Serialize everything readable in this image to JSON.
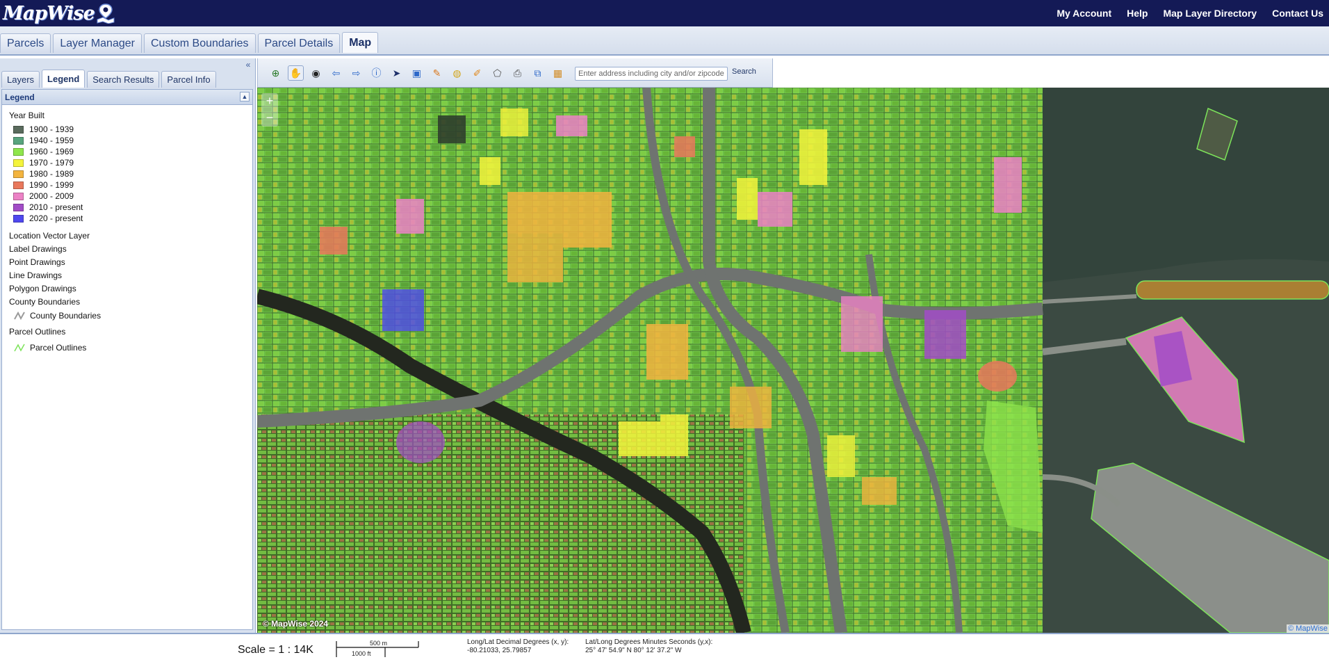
{
  "app": {
    "logo": "MapWise",
    "top_links": [
      "My Account",
      "Help",
      "Map Layer Directory",
      "Contact Us"
    ]
  },
  "main_tabs": [
    {
      "label": "Parcels",
      "active": false
    },
    {
      "label": "Layer Manager",
      "active": false
    },
    {
      "label": "Custom Boundaries",
      "active": false
    },
    {
      "label": "Parcel Details",
      "active": false
    },
    {
      "label": "Map",
      "active": true
    }
  ],
  "left_panel": {
    "collapse_icon": "double-chevron-left-icon",
    "tabs": [
      {
        "label": "Layers",
        "active": false
      },
      {
        "label": "Legend",
        "active": true
      },
      {
        "label": "Search Results",
        "active": false
      },
      {
        "label": "Parcel Info",
        "active": false
      }
    ],
    "legend_header": "Legend",
    "year_built_title": "Year Built",
    "year_built": [
      {
        "label": "1900 - 1939",
        "color": "#5a6b5d"
      },
      {
        "label": "1940 - 1959",
        "color": "#58a47e"
      },
      {
        "label": "1960 - 1969",
        "color": "#8fe64c"
      },
      {
        "label": "1970 - 1979",
        "color": "#f4f43c"
      },
      {
        "label": "1980 - 1989",
        "color": "#f3b43f"
      },
      {
        "label": "1990 - 1999",
        "color": "#e9785c"
      },
      {
        "label": "2000 - 2009",
        "color": "#ec82c6"
      },
      {
        "label": "2010 - present",
        "color": "#a24cc7"
      },
      {
        "label": "2020 - present",
        "color": "#4f48ef"
      }
    ],
    "layers": [
      "Location Vector Layer",
      "Label Drawings",
      "Point Drawings",
      "Line Drawings",
      "Polygon Drawings",
      "County Boundaries"
    ],
    "county_boundaries_symbol": "County Boundaries",
    "parcel_outlines_title": "Parcel Outlines",
    "parcel_outlines_symbol": "Parcel Outlines"
  },
  "toolbar": {
    "tools": [
      {
        "name": "zoom-in-icon",
        "glyph": "⊕",
        "color": "#2a7a2a",
        "active": false
      },
      {
        "name": "pan-hand-icon",
        "glyph": "✋",
        "color": "#333333",
        "active": true
      },
      {
        "name": "full-extent-icon",
        "glyph": "◉",
        "color": "#222222",
        "active": false
      },
      {
        "name": "back-arrow-icon",
        "glyph": "⇦",
        "color": "#2d68c9",
        "active": false
      },
      {
        "name": "forward-arrow-icon",
        "glyph": "⇨",
        "color": "#2d68c9",
        "active": false
      },
      {
        "name": "info-icon",
        "glyph": "ⓘ",
        "color": "#2d68c9",
        "active": false
      },
      {
        "name": "select-pointer-icon",
        "glyph": "➤",
        "color": "#1d2f6a",
        "active": false
      },
      {
        "name": "select-box-icon",
        "glyph": "▣",
        "color": "#2d68c9",
        "active": false
      },
      {
        "name": "draw-pencil-icon",
        "glyph": "✎",
        "color": "#d9781f",
        "active": false
      },
      {
        "name": "measure-globe-icon",
        "glyph": "◍",
        "color": "#d2a61e",
        "active": false
      },
      {
        "name": "draw-tools-icon",
        "glyph": "✐",
        "color": "#e08a20",
        "active": false
      },
      {
        "name": "polygon-draw-icon",
        "glyph": "⬠",
        "color": "#555555",
        "active": false
      },
      {
        "name": "print-icon",
        "glyph": "⎙",
        "color": "#444444",
        "active": false
      },
      {
        "name": "copy-layers-icon",
        "glyph": "⧉",
        "color": "#2d68c9",
        "active": false
      },
      {
        "name": "export-image-icon",
        "glyph": "▦",
        "color": "#d28a20",
        "active": false
      }
    ],
    "search_placeholder": "Enter address including city and/or zipcode.",
    "search_label": "Search"
  },
  "map": {
    "zoom_in": "+",
    "zoom_out": "−",
    "copyright_left": "© MapWise 2024",
    "copyright_right": "© MapWise"
  },
  "status": {
    "scale": "Scale = 1 : 14K",
    "scalebar_top": "500 m",
    "scalebar_bottom": "1000 ft",
    "decimal_label": "Long/Lat Decimal Degrees (x, y):",
    "decimal_value": "-80.21033, 25.79857",
    "dms_label": "Lat/Long Degrees Minutes Seconds (y,x):",
    "dms_value": "25° 47' 54.9\" N 80° 12' 37.2\" W"
  }
}
